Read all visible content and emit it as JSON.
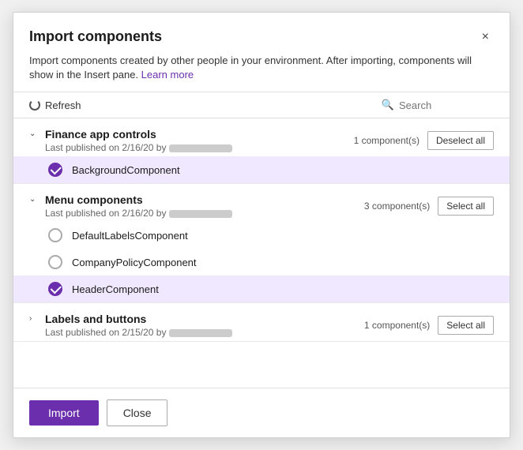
{
  "dialog": {
    "title": "Import components",
    "close_label": "×",
    "description": "Import components created by other people in your environment. After importing, components will show in the Insert pane.",
    "learn_more_label": "Learn more",
    "toolbar": {
      "refresh_label": "Refresh",
      "search_placeholder": "Search"
    },
    "sections": [
      {
        "id": "finance",
        "title": "Finance app controls",
        "subtitle": "Last published on 2/16/20 by",
        "component_count": "1 component(s)",
        "button_label": "Deselect all",
        "expanded": true,
        "items": [
          {
            "name": "BackgroundComponent",
            "selected": true
          }
        ]
      },
      {
        "id": "menu",
        "title": "Menu components",
        "subtitle": "Last published on 2/16/20 by",
        "component_count": "3 component(s)",
        "button_label": "Select all",
        "expanded": true,
        "items": [
          {
            "name": "DefaultLabelsComponent",
            "selected": false
          },
          {
            "name": "CompanyPolicyComponent",
            "selected": false
          },
          {
            "name": "HeaderComponent",
            "selected": true
          }
        ]
      },
      {
        "id": "labels",
        "title": "Labels and buttons",
        "subtitle": "Last published on 2/15/20 by",
        "component_count": "1 component(s)",
        "button_label": "Select all",
        "expanded": false,
        "items": []
      }
    ],
    "footer": {
      "import_label": "Import",
      "close_label": "Close"
    }
  }
}
